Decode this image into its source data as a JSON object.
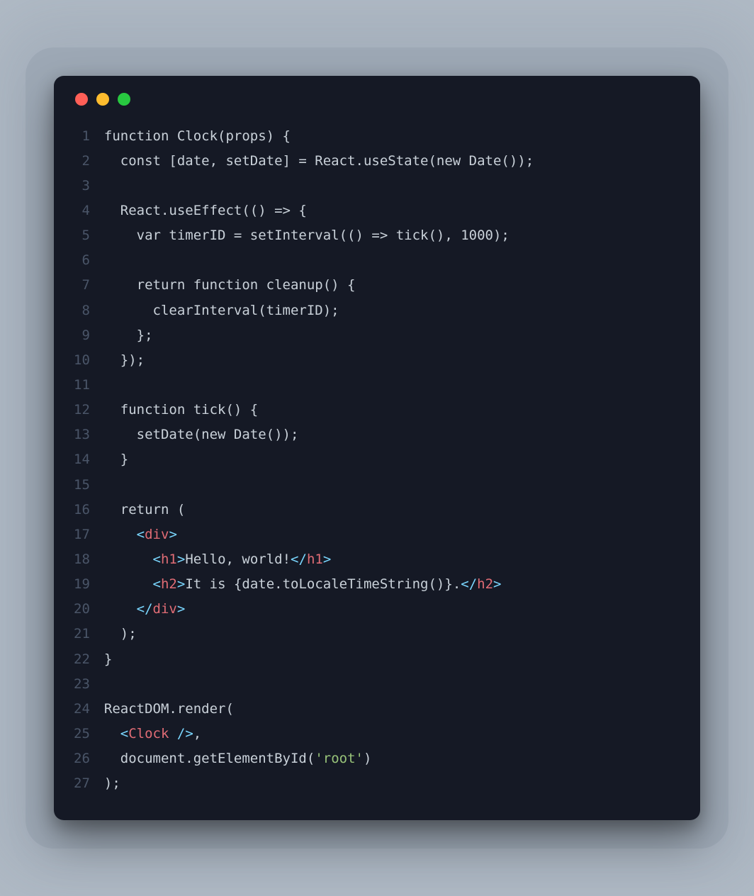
{
  "colors": {
    "background": "#b0bac5",
    "window": "#151925",
    "red": "#ff5f57",
    "yellow": "#febc2e",
    "green": "#28c840",
    "gutter": "#4a5568",
    "default": "#c9d1d9",
    "punct": "#89a0b8",
    "bracket": "#7ad7ff",
    "tag": "#e06c75",
    "string": "#98c379"
  },
  "line_count": 27,
  "code_lines": [
    [
      [
        "default",
        "function Clock(props) {"
      ]
    ],
    [
      [
        "default",
        "  const [date, setDate] = React.useState(new Date());"
      ]
    ],
    [],
    [
      [
        "default",
        "  React.useEffect(() => {"
      ]
    ],
    [
      [
        "default",
        "    var timerID = setInterval(() => tick(), 1000);"
      ]
    ],
    [],
    [
      [
        "default",
        "    return function cleanup() {"
      ]
    ],
    [
      [
        "default",
        "      clearInterval(timerID);"
      ]
    ],
    [
      [
        "default",
        "    };"
      ]
    ],
    [
      [
        "default",
        "  });"
      ]
    ],
    [],
    [
      [
        "default",
        "  function tick() {"
      ]
    ],
    [
      [
        "default",
        "    setDate(new Date());"
      ]
    ],
    [
      [
        "default",
        "  }"
      ]
    ],
    [],
    [
      [
        "default",
        "  return ("
      ]
    ],
    [
      [
        "default",
        "    "
      ],
      [
        "bracket",
        "<"
      ],
      [
        "tag",
        "div"
      ],
      [
        "bracket",
        ">"
      ]
    ],
    [
      [
        "default",
        "      "
      ],
      [
        "bracket",
        "<"
      ],
      [
        "tag",
        "h1"
      ],
      [
        "bracket",
        ">"
      ],
      [
        "default",
        "Hello, world!"
      ],
      [
        "bracket",
        "</"
      ],
      [
        "tag",
        "h1"
      ],
      [
        "bracket",
        ">"
      ]
    ],
    [
      [
        "default",
        "      "
      ],
      [
        "bracket",
        "<"
      ],
      [
        "tag",
        "h2"
      ],
      [
        "bracket",
        ">"
      ],
      [
        "default",
        "It is {date.toLocaleTimeString()}."
      ],
      [
        "bracket",
        "</"
      ],
      [
        "tag",
        "h2"
      ],
      [
        "bracket",
        ">"
      ]
    ],
    [
      [
        "default",
        "    "
      ],
      [
        "bracket",
        "</"
      ],
      [
        "tag",
        "div"
      ],
      [
        "bracket",
        ">"
      ]
    ],
    [
      [
        "default",
        "  );"
      ]
    ],
    [
      [
        "default",
        "}"
      ]
    ],
    [],
    [
      [
        "default",
        "ReactDOM.render("
      ]
    ],
    [
      [
        "default",
        "  "
      ],
      [
        "bracket",
        "<"
      ],
      [
        "tag",
        "Clock"
      ],
      [
        "default",
        " "
      ],
      [
        "bracket",
        "/>"
      ],
      [
        "default",
        ","
      ]
    ],
    [
      [
        "default",
        "  document.getElementById("
      ],
      [
        "string",
        "'root'"
      ],
      [
        "default",
        ")"
      ]
    ],
    [
      [
        "default",
        ");"
      ]
    ]
  ]
}
